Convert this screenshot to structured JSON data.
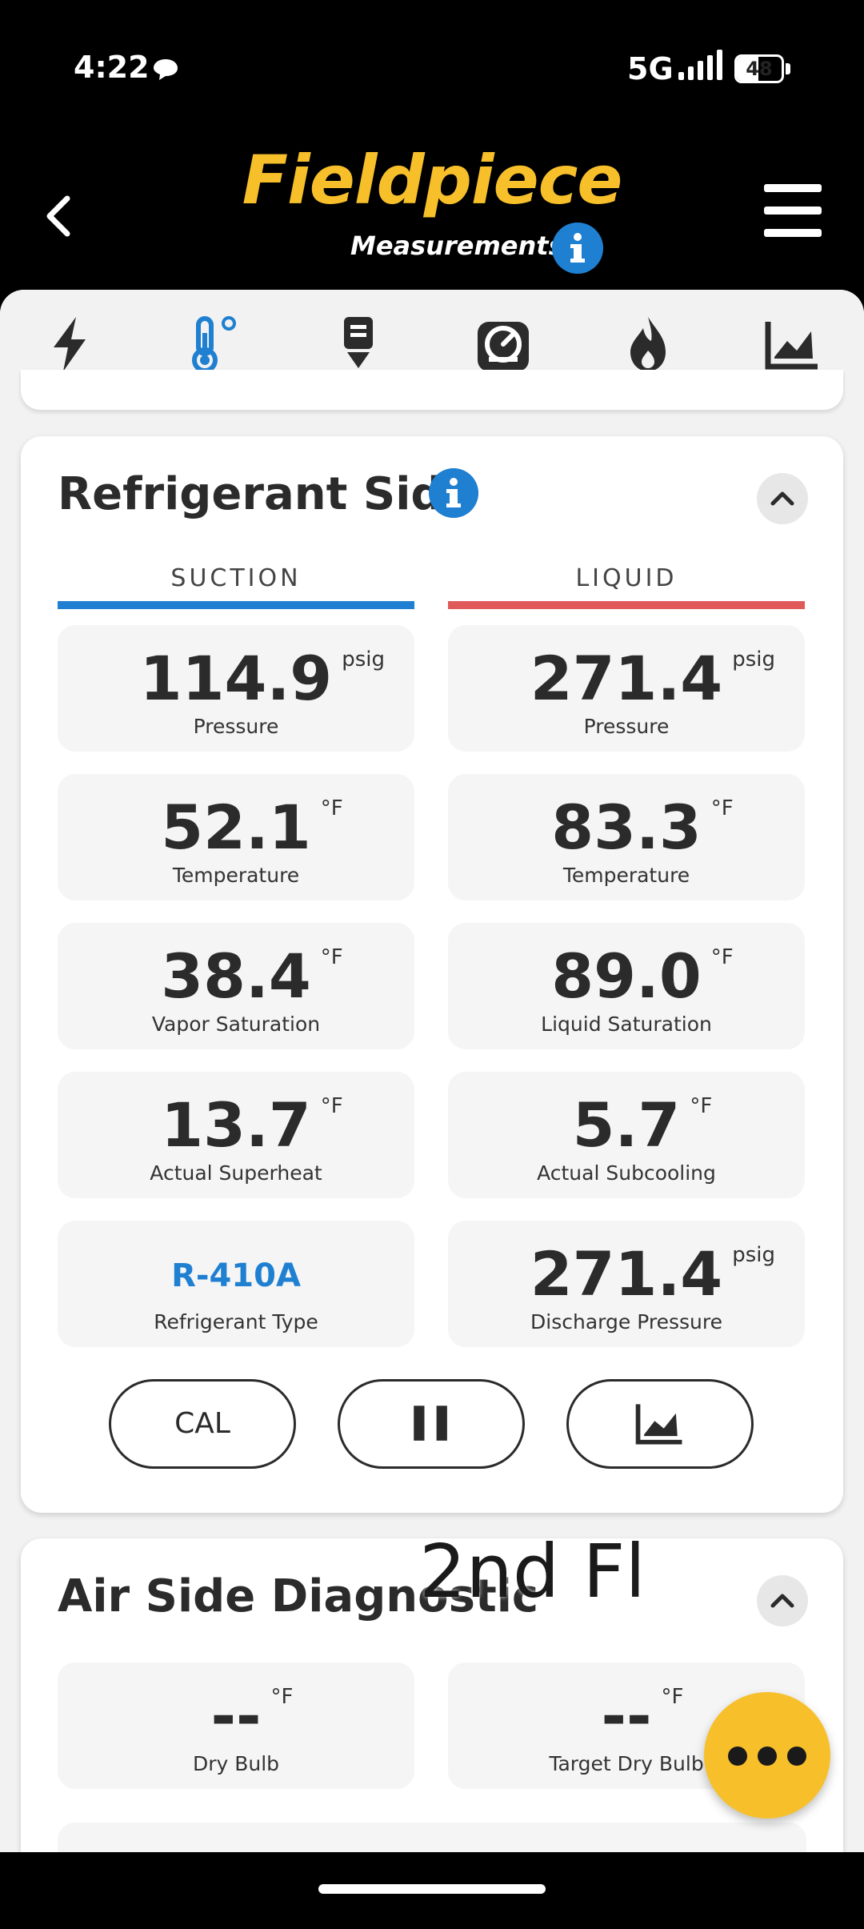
{
  "status_bar": {
    "time": "4:22",
    "network": "5G",
    "battery": "48",
    "battery_fraction": 0.48
  },
  "header": {
    "brand": "Fieldpiece",
    "subtitle": "Measurements"
  },
  "tabs": [
    {
      "icon": "lightning-icon"
    },
    {
      "icon": "thermometer-icon",
      "active": true
    },
    {
      "icon": "probe-download-icon"
    },
    {
      "icon": "gauge-icon"
    },
    {
      "icon": "flame-icon"
    },
    {
      "icon": "trend-chart-icon"
    }
  ],
  "refrigerant_side": {
    "title": "Refrigerant Side",
    "suction_label": "SUCTION",
    "liquid_label": "LIQUID",
    "suction": [
      {
        "value": "114.9",
        "unit": "psig",
        "label": "Pressure"
      },
      {
        "value": "52.1",
        "unit": "°F",
        "label": "Temperature"
      },
      {
        "value": "38.4",
        "unit": "°F",
        "label": "Vapor Saturation"
      },
      {
        "value": "13.7",
        "unit": "°F",
        "label": "Actual Superheat"
      }
    ],
    "liquid": [
      {
        "value": "271.4",
        "unit": "psig",
        "label": "Pressure"
      },
      {
        "value": "83.3",
        "unit": "°F",
        "label": "Temperature"
      },
      {
        "value": "89.0",
        "unit": "°F",
        "label": "Liquid Saturation"
      },
      {
        "value": "5.7",
        "unit": "°F",
        "label": "Actual Subcooling"
      },
      {
        "value": "271.4",
        "unit": "psig",
        "label": "Discharge Pressure"
      }
    ],
    "refrigerant": {
      "value": "R-410A",
      "label": "Refrigerant Type"
    },
    "buttons": {
      "cal": "CAL"
    }
  },
  "air_side": {
    "title": "Air Side Diagnostic",
    "cells": [
      {
        "value": "--",
        "unit": "°F",
        "label": "Dry Bulb"
      },
      {
        "value": "--",
        "unit": "°F",
        "label": "Target Dry Bulb"
      }
    ]
  },
  "overlay_text": "2nd Fl",
  "colors": {
    "brand_yellow": "#f7c02b",
    "suction_blue": "#1f7fd1",
    "liquid_red": "#e05a5a"
  }
}
